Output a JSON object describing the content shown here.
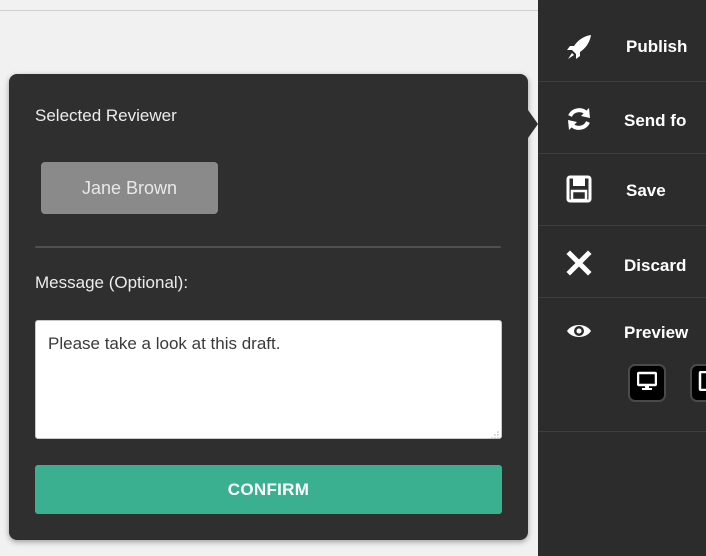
{
  "sidebar": {
    "items": [
      {
        "label": "Publish",
        "icon": "rocket-icon"
      },
      {
        "label": "Send fo",
        "icon": "refresh-icon"
      },
      {
        "label": "Save",
        "icon": "floppy-disk-icon"
      },
      {
        "label": "Discard",
        "icon": "close-icon"
      },
      {
        "label": "Preview",
        "icon": "eye-icon"
      }
    ],
    "preview_devices": [
      {
        "icon": "desktop-icon"
      },
      {
        "icon": "tablet-icon"
      }
    ]
  },
  "popup": {
    "title": "Selected Reviewer",
    "reviewer_name": "Jane Brown",
    "message_label": "Message (Optional):",
    "message_value": "Please take a look at this draft.",
    "confirm_label": "CONFIRM"
  },
  "colors": {
    "sidebar_bg": "#2c2c2c",
    "popup_bg": "#2f2f2f",
    "accent_green": "#3bb091",
    "reviewer_chip": "#8a8a8a"
  }
}
